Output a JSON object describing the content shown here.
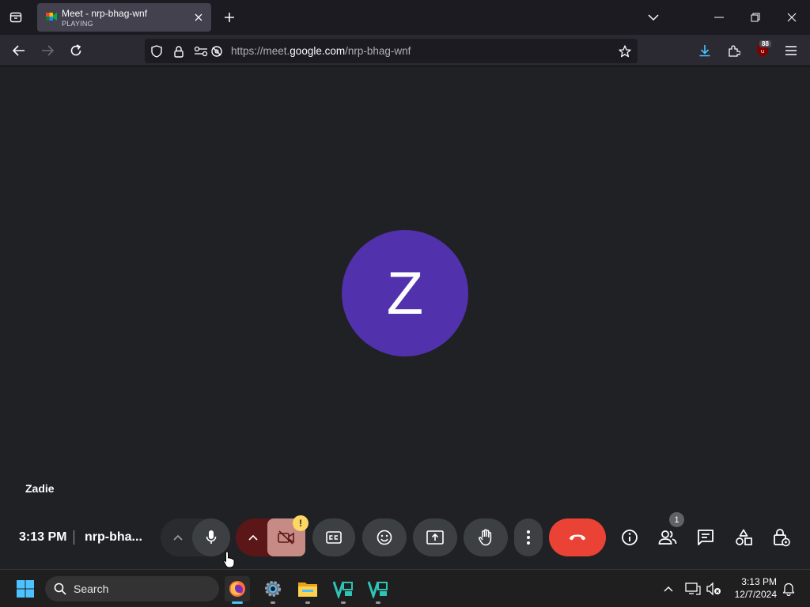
{
  "browser": {
    "tab": {
      "title": "Meet - nrp-bhag-wnf",
      "status": "PLAYING"
    },
    "url": {
      "prefix": "https://meet.",
      "domain": "google.com",
      "path": "/nrp-bhag-wnf"
    },
    "extension_badge": "88"
  },
  "meeting": {
    "avatar_initial": "Z",
    "avatar_color": "#5231ac",
    "participant_name": "Zadie",
    "time": "3:13 PM",
    "code": "nrp-bha...",
    "people_count": "1",
    "warning_glyph": "!"
  },
  "controls": [
    {
      "name": "mic-options",
      "icon": "chevron-up-icon"
    },
    {
      "name": "mic",
      "icon": "microphone-icon"
    },
    {
      "name": "camera-options",
      "icon": "chevron-up-icon"
    },
    {
      "name": "camera",
      "icon": "camera-off-icon"
    },
    {
      "name": "captions",
      "icon": "captions-icon"
    },
    {
      "name": "reactions",
      "icon": "emoji-icon"
    },
    {
      "name": "present",
      "icon": "present-screen-icon"
    },
    {
      "name": "raise-hand",
      "icon": "hand-icon"
    },
    {
      "name": "more-options",
      "icon": "more-vert-icon"
    },
    {
      "name": "end-call",
      "icon": "phone-hangup-icon"
    }
  ],
  "side_controls": [
    "info-icon",
    "people-icon",
    "chat-icon",
    "activities-icon",
    "host-controls-icon"
  ],
  "taskbar": {
    "search_label": "Search",
    "time": "3:13 PM",
    "date": "12/7/2024"
  }
}
